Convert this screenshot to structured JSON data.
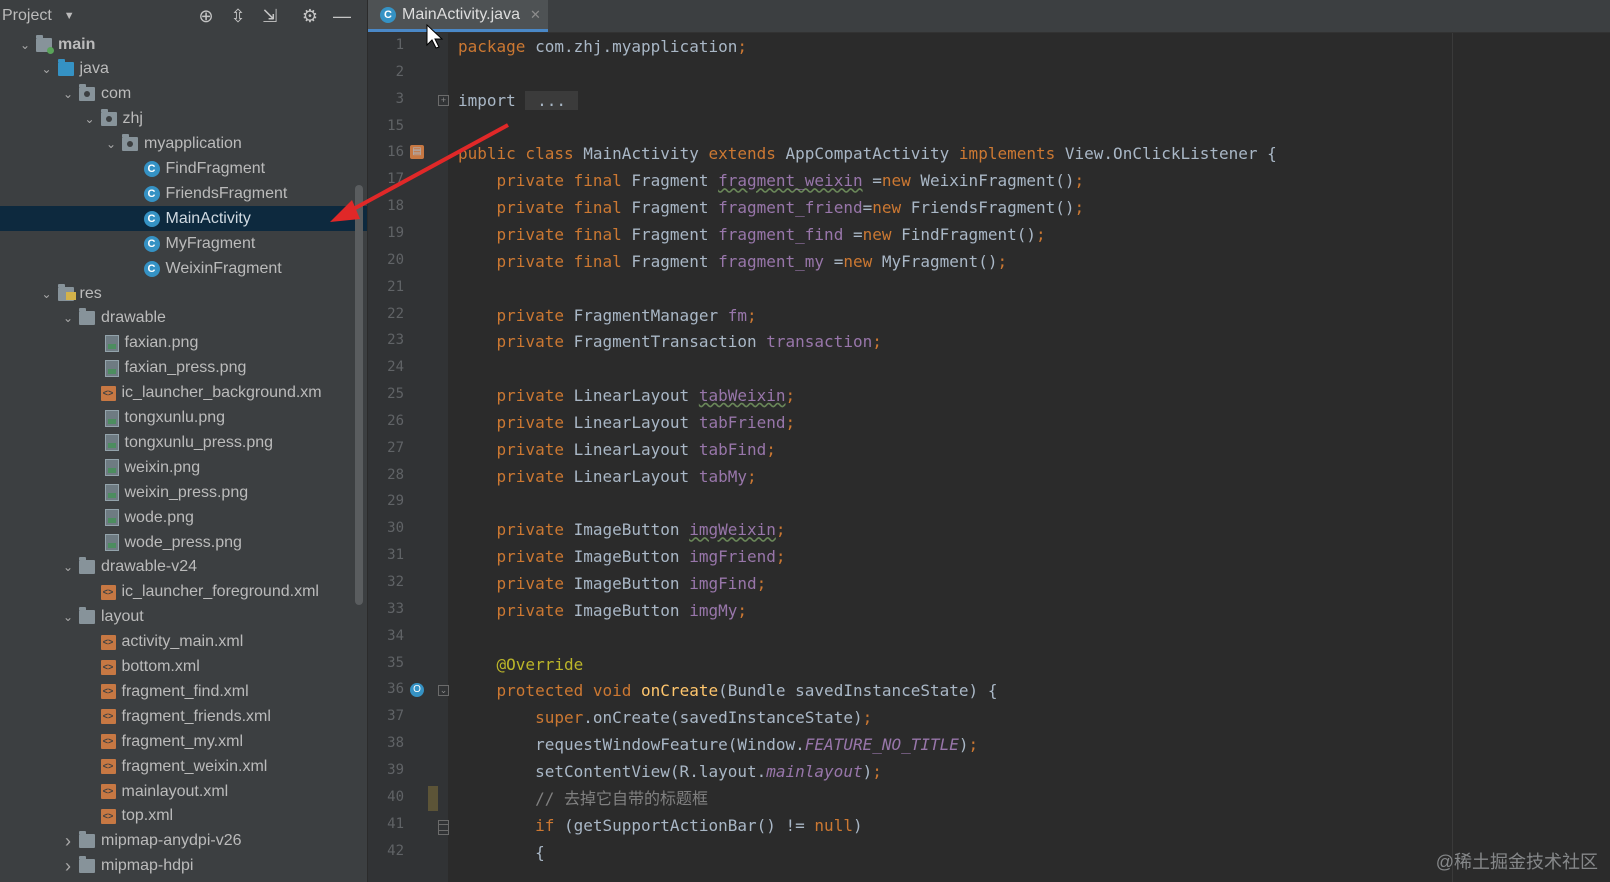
{
  "colors": {
    "keyword": "#cc7832",
    "field": "#9876aa",
    "method": "#ffc66d",
    "annotation": "#bbb529",
    "comment": "#808080",
    "plain": "#a9b7c6",
    "selection": "#0d293e",
    "tab_underline": "#4a88c7",
    "arrow": "#e02828"
  },
  "sidebar": {
    "title": "Project",
    "tools": [
      "locate-icon",
      "expand-all-icon",
      "collapse-all-icon",
      "gear-icon",
      "hide-icon"
    ],
    "items": [
      {
        "label": "main",
        "depth": 1,
        "expanded": true,
        "icon": "module-folder-icon"
      },
      {
        "label": "java",
        "depth": 2,
        "expanded": true,
        "icon": "source-folder-icon"
      },
      {
        "label": "com",
        "depth": 3,
        "expanded": true,
        "icon": "package-icon"
      },
      {
        "label": "zhj",
        "depth": 4,
        "expanded": true,
        "icon": "package-icon"
      },
      {
        "label": "myapplication",
        "depth": 5,
        "expanded": true,
        "icon": "package-icon"
      },
      {
        "label": "FindFragment",
        "depth": 6,
        "icon": "class-icon"
      },
      {
        "label": "FriendsFragment",
        "depth": 6,
        "icon": "class-icon"
      },
      {
        "label": "MainActivity",
        "depth": 6,
        "icon": "class-icon",
        "selected": true
      },
      {
        "label": "MyFragment",
        "depth": 6,
        "icon": "class-icon"
      },
      {
        "label": "WeixinFragment",
        "depth": 6,
        "icon": "class-icon"
      },
      {
        "label": "res",
        "depth": 2,
        "expanded": true,
        "icon": "res-folder-icon"
      },
      {
        "label": "drawable",
        "depth": 3,
        "expanded": true,
        "icon": "folder-icon"
      },
      {
        "label": "faxian.png",
        "depth": 4,
        "icon": "image-file-icon"
      },
      {
        "label": "faxian_press.png",
        "depth": 4,
        "icon": "image-file-icon"
      },
      {
        "label": "ic_launcher_background.xm",
        "depth": 4,
        "icon": "xml-file-icon"
      },
      {
        "label": "tongxunlu.png",
        "depth": 4,
        "icon": "image-file-icon"
      },
      {
        "label": "tongxunlu_press.png",
        "depth": 4,
        "icon": "image-file-icon"
      },
      {
        "label": "weixin.png",
        "depth": 4,
        "icon": "image-file-icon"
      },
      {
        "label": "weixin_press.png",
        "depth": 4,
        "icon": "image-file-icon"
      },
      {
        "label": "wode.png",
        "depth": 4,
        "icon": "image-file-icon"
      },
      {
        "label": "wode_press.png",
        "depth": 4,
        "icon": "image-file-icon"
      },
      {
        "label": "drawable-v24",
        "depth": 3,
        "expanded": true,
        "icon": "folder-icon"
      },
      {
        "label": "ic_launcher_foreground.xml",
        "depth": 4,
        "icon": "xml-file-icon"
      },
      {
        "label": "layout",
        "depth": 3,
        "expanded": true,
        "icon": "folder-icon"
      },
      {
        "label": "activity_main.xml",
        "depth": 4,
        "icon": "xml-file-icon"
      },
      {
        "label": "bottom.xml",
        "depth": 4,
        "icon": "xml-file-icon"
      },
      {
        "label": "fragment_find.xml",
        "depth": 4,
        "icon": "xml-file-icon"
      },
      {
        "label": "fragment_friends.xml",
        "depth": 4,
        "icon": "xml-file-icon"
      },
      {
        "label": "fragment_my.xml",
        "depth": 4,
        "icon": "xml-file-icon"
      },
      {
        "label": "fragment_weixin.xml",
        "depth": 4,
        "icon": "xml-file-icon"
      },
      {
        "label": "mainlayout.xml",
        "depth": 4,
        "icon": "xml-file-icon"
      },
      {
        "label": "top.xml",
        "depth": 4,
        "icon": "xml-file-icon"
      },
      {
        "label": "mipmap-anydpi-v26",
        "depth": 3,
        "expanded": false,
        "icon": "folder-icon"
      },
      {
        "label": "mipmap-hdpi",
        "depth": 3,
        "expanded": false,
        "icon": "folder-icon"
      }
    ]
  },
  "editor": {
    "tab_label": "MainActivity.java",
    "lines": [
      {
        "n": "1",
        "tokens": [
          [
            "kw",
            "package "
          ],
          [
            "id",
            "com.zhj.myapplication"
          ],
          [
            "kw",
            ";"
          ]
        ]
      },
      {
        "n": "2",
        "tokens": []
      },
      {
        "n": "3",
        "tokens": [
          [
            "id",
            "import "
          ],
          [
            "fold",
            " ... "
          ]
        ]
      },
      {
        "n": "15",
        "tokens": []
      },
      {
        "n": "16",
        "tokens": [
          [
            "kw",
            "public class "
          ],
          [
            "id",
            "MainActivity "
          ],
          [
            "kw",
            "extends "
          ],
          [
            "id",
            "AppCompatActivity "
          ],
          [
            "kw",
            "implements "
          ],
          [
            "id",
            "View.OnClickListener {"
          ]
        ]
      },
      {
        "n": "17",
        "tokens": [
          [
            "id",
            "    "
          ],
          [
            "kw",
            "private final "
          ],
          [
            "id",
            "Fragment "
          ],
          [
            "fldw",
            "fragment_weixin"
          ],
          [
            "id",
            " ="
          ],
          [
            "kw",
            "new "
          ],
          [
            "id",
            "WeixinFragment()"
          ],
          [
            "kw",
            ";"
          ]
        ]
      },
      {
        "n": "18",
        "tokens": [
          [
            "id",
            "    "
          ],
          [
            "kw",
            "private final "
          ],
          [
            "id",
            "Fragment "
          ],
          [
            "fld",
            "fragment_friend"
          ],
          [
            "id",
            "="
          ],
          [
            "kw",
            "new "
          ],
          [
            "id",
            "FriendsFragment()"
          ],
          [
            "kw",
            ";"
          ]
        ]
      },
      {
        "n": "19",
        "tokens": [
          [
            "id",
            "    "
          ],
          [
            "kw",
            "private final "
          ],
          [
            "id",
            "Fragment "
          ],
          [
            "fld",
            "fragment_find "
          ],
          [
            "id",
            "="
          ],
          [
            "kw",
            "new "
          ],
          [
            "id",
            "FindFragment()"
          ],
          [
            "kw",
            ";"
          ]
        ]
      },
      {
        "n": "20",
        "tokens": [
          [
            "id",
            "    "
          ],
          [
            "kw",
            "private final "
          ],
          [
            "id",
            "Fragment "
          ],
          [
            "fld",
            "fragment_my "
          ],
          [
            "id",
            "="
          ],
          [
            "kw",
            "new "
          ],
          [
            "id",
            "MyFragment()"
          ],
          [
            "kw",
            ";"
          ]
        ]
      },
      {
        "n": "21",
        "tokens": []
      },
      {
        "n": "22",
        "tokens": [
          [
            "id",
            "    "
          ],
          [
            "kw",
            "private "
          ],
          [
            "id",
            "FragmentManager "
          ],
          [
            "fld",
            "fm"
          ],
          [
            "kw",
            ";"
          ]
        ]
      },
      {
        "n": "23",
        "tokens": [
          [
            "id",
            "    "
          ],
          [
            "kw",
            "private "
          ],
          [
            "id",
            "FragmentTransaction "
          ],
          [
            "fld",
            "transaction"
          ],
          [
            "kw",
            ";"
          ]
        ]
      },
      {
        "n": "24",
        "tokens": []
      },
      {
        "n": "25",
        "tokens": [
          [
            "id",
            "    "
          ],
          [
            "kw",
            "private "
          ],
          [
            "id",
            "LinearLayout "
          ],
          [
            "fldw",
            "tabWeixin"
          ],
          [
            "kw",
            ";"
          ]
        ]
      },
      {
        "n": "26",
        "tokens": [
          [
            "id",
            "    "
          ],
          [
            "kw",
            "private "
          ],
          [
            "id",
            "LinearLayout "
          ],
          [
            "fld",
            "tabFriend"
          ],
          [
            "kw",
            ";"
          ]
        ]
      },
      {
        "n": "27",
        "tokens": [
          [
            "id",
            "    "
          ],
          [
            "kw",
            "private "
          ],
          [
            "id",
            "LinearLayout "
          ],
          [
            "fld",
            "tabFind"
          ],
          [
            "kw",
            ";"
          ]
        ]
      },
      {
        "n": "28",
        "tokens": [
          [
            "id",
            "    "
          ],
          [
            "kw",
            "private "
          ],
          [
            "id",
            "LinearLayout "
          ],
          [
            "fld",
            "tabMy"
          ],
          [
            "kw",
            ";"
          ]
        ]
      },
      {
        "n": "29",
        "tokens": []
      },
      {
        "n": "30",
        "tokens": [
          [
            "id",
            "    "
          ],
          [
            "kw",
            "private "
          ],
          [
            "id",
            "ImageButton "
          ],
          [
            "fldw",
            "imgWeixin"
          ],
          [
            "kw",
            ";"
          ]
        ]
      },
      {
        "n": "31",
        "tokens": [
          [
            "id",
            "    "
          ],
          [
            "kw",
            "private "
          ],
          [
            "id",
            "ImageButton "
          ],
          [
            "fld",
            "imgFriend"
          ],
          [
            "kw",
            ";"
          ]
        ]
      },
      {
        "n": "32",
        "tokens": [
          [
            "id",
            "    "
          ],
          [
            "kw",
            "private "
          ],
          [
            "id",
            "ImageButton "
          ],
          [
            "fld",
            "imgFind"
          ],
          [
            "kw",
            ";"
          ]
        ]
      },
      {
        "n": "33",
        "tokens": [
          [
            "id",
            "    "
          ],
          [
            "kw",
            "private "
          ],
          [
            "id",
            "ImageButton "
          ],
          [
            "fld",
            "imgMy"
          ],
          [
            "kw",
            ";"
          ]
        ]
      },
      {
        "n": "34",
        "tokens": []
      },
      {
        "n": "35",
        "tokens": [
          [
            "id",
            "    "
          ],
          [
            "ann",
            "@Override"
          ]
        ]
      },
      {
        "n": "36",
        "tokens": [
          [
            "id",
            "    "
          ],
          [
            "kw",
            "protected void "
          ],
          [
            "mth",
            "onCreate"
          ],
          [
            "id",
            "(Bundle savedInstanceState) {"
          ]
        ]
      },
      {
        "n": "37",
        "tokens": [
          [
            "id",
            "        "
          ],
          [
            "kw",
            "super"
          ],
          [
            "id",
            ".onCreate(savedInstanceState)"
          ],
          [
            "kw",
            ";"
          ]
        ]
      },
      {
        "n": "38",
        "tokens": [
          [
            "id",
            "        requestWindowFeature(Window."
          ],
          [
            "st",
            "FEATURE_NO_TITLE"
          ],
          [
            "id",
            ")"
          ],
          [
            "kw",
            ";"
          ]
        ]
      },
      {
        "n": "39",
        "tokens": [
          [
            "id",
            "        setContentView(R.layout."
          ],
          [
            "st",
            "mainlayout"
          ],
          [
            "id",
            ")"
          ],
          [
            "kw",
            ";"
          ]
        ]
      },
      {
        "n": "40",
        "tokens": [
          [
            "id",
            "        "
          ],
          [
            "cmt",
            "// 去掉它自带的标题框"
          ]
        ]
      },
      {
        "n": "41",
        "tokens": [
          [
            "id",
            "        "
          ],
          [
            "kw",
            "if "
          ],
          [
            "id",
            "(getSupportActionBar() != "
          ],
          [
            "kw",
            "null"
          ],
          [
            "id",
            ")"
          ]
        ]
      },
      {
        "n": "42",
        "tokens": [
          [
            "id",
            "        {"
          ]
        ]
      }
    ]
  },
  "watermark": "@稀土掘金技术社区"
}
